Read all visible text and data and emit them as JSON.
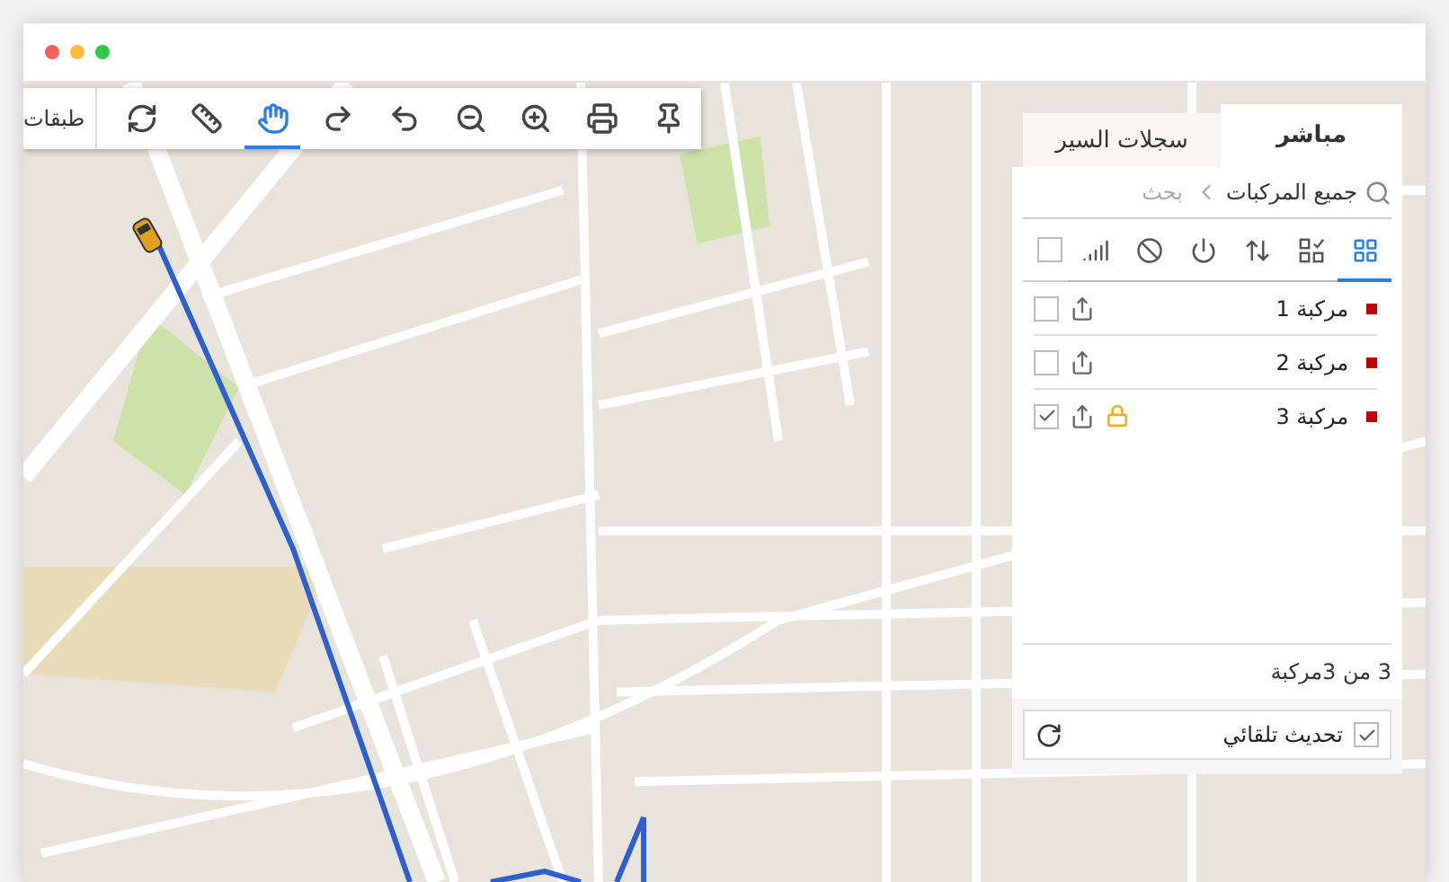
{
  "toolbar": {
    "layers_label": "طبقات",
    "tools": [
      {
        "kind": "refresh",
        "selected": false
      },
      {
        "kind": "ruler",
        "selected": false
      },
      {
        "kind": "pan",
        "selected": true
      },
      {
        "kind": "redo",
        "selected": false
      },
      {
        "kind": "undo",
        "selected": false
      },
      {
        "kind": "zoom_out",
        "selected": false
      },
      {
        "kind": "zoom_in",
        "selected": false
      },
      {
        "kind": "print",
        "selected": false
      },
      {
        "kind": "pin",
        "selected": false
      }
    ]
  },
  "panel": {
    "tabs": [
      {
        "label": "مباشر",
        "selected": true
      },
      {
        "label": "سجلات السير",
        "selected": false
      }
    ],
    "search": {
      "scope": "جميع المركبات",
      "placeholder": "بحث"
    },
    "filters": [
      {
        "kind": "grid",
        "selected": true
      },
      {
        "kind": "checklist",
        "selected": false
      },
      {
        "kind": "sort",
        "selected": false
      },
      {
        "kind": "power",
        "selected": false
      },
      {
        "kind": "blocked",
        "selected": false
      },
      {
        "kind": "signal",
        "selected": false
      }
    ],
    "select_all": {
      "checked": false
    },
    "vehicles": [
      {
        "name": "مركبة 1",
        "color": "#c00000",
        "locked": false,
        "checked": false
      },
      {
        "name": "مركبة 2",
        "color": "#c00000",
        "locked": false,
        "checked": false
      },
      {
        "name": "مركبة 3",
        "color": "#c00000",
        "locked": true,
        "checked": true
      }
    ],
    "count": "3 من 3مركبة",
    "auto_refresh": {
      "label": "تحديث تلقائي",
      "checked": true
    }
  }
}
